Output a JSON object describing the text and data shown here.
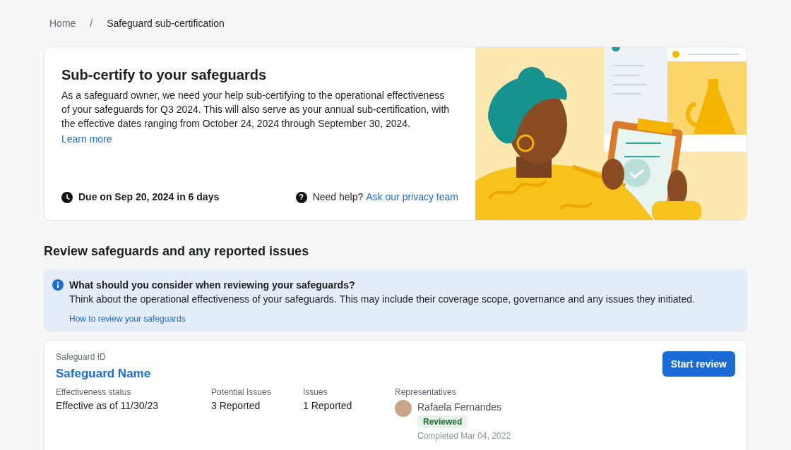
{
  "breadcrumb": {
    "items": [
      {
        "label": "Home",
        "current": false
      },
      {
        "label": "Safeguard sub-certification",
        "current": true
      }
    ],
    "separator": "/"
  },
  "hero": {
    "title": "Sub-certify to your safeguards",
    "body": "As a safeguard owner, we need your help sub-certifying to the operational effectiveness of your safeguards for Q3 2024. This will also serve as your annual sub-certification, with the effective dates ranging from October 24, 2024 through September 30, 2024.",
    "link": "Learn more",
    "due": "Due on Sep 20, 2024 in 6 days",
    "help_icon": "?",
    "help_label": "Need help?",
    "help_link": "Ask our privacy team"
  },
  "section_title": "Review safeguards and any reported issues",
  "info": {
    "title": "What should you consider when reviewing your safeguards?",
    "body": "Think about the operational effectiveness of your safeguards. This may include their coverage scope, governance and any issues they initiated.",
    "link": "How to review your safeguards"
  },
  "safeguard": {
    "id_label": "Safeguard ID",
    "name": "Safeguard Name",
    "button": "Start review",
    "fields": [
      {
        "label": "Effectiveness status",
        "value": "Effective as of 11/30/23"
      },
      {
        "label": "Potential Issues",
        "value": "3 Reported"
      },
      {
        "label": "Issues",
        "value": "1 Reported"
      }
    ],
    "representatives": {
      "label": "Representatives",
      "people": [
        {
          "name": "Rafaela Fernandes",
          "status": "Reviewed",
          "completed": "Completed Mar 04, 2022"
        }
      ]
    }
  }
}
